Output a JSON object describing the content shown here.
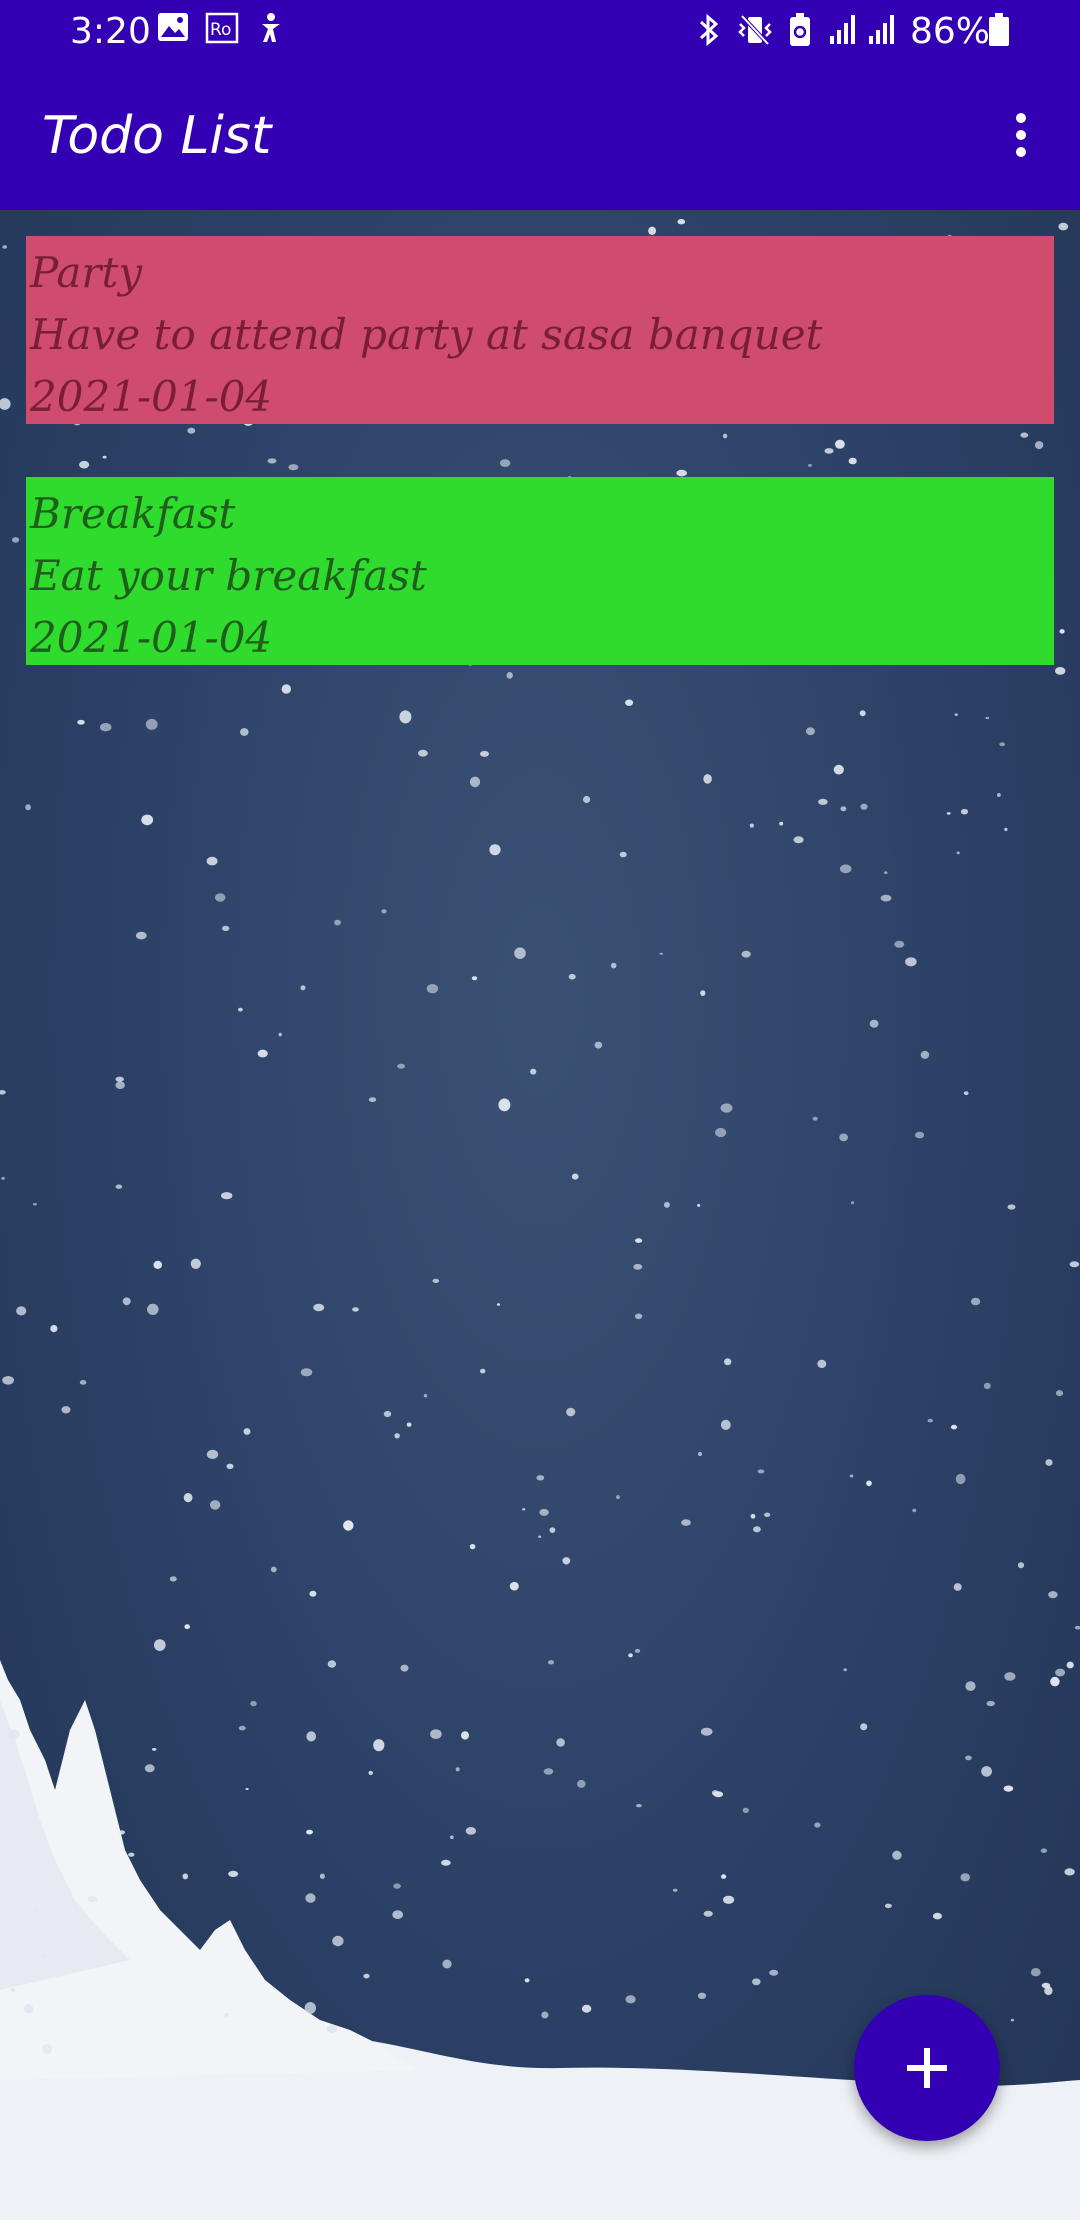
{
  "status_bar": {
    "time": "3:20",
    "battery_percent": "86%",
    "icons": [
      "gallery-icon",
      "ro-badge-icon",
      "accessibility-icon",
      "bluetooth-icon",
      "vibrate-icon",
      "battery-saver-icon",
      "signal-icon",
      "signal-icon",
      "battery-icon"
    ]
  },
  "app_bar": {
    "title": "Todo List",
    "menu_icon": "more-vert-icon"
  },
  "todos": [
    {
      "title": "Party",
      "description": "Have to attend party at sasa banquet",
      "date": "2021-01-04",
      "background_color": "#cf4c6f",
      "text_color": "#7a1f33"
    },
    {
      "title": "Breakfast",
      "description": "Eat your breakfast",
      "date": "2021-01-04",
      "background_color": "#2fdb2c",
      "text_color": "#1f5e1c"
    }
  ],
  "fab": {
    "icon": "plus-icon",
    "color": "#3300b3"
  },
  "colors": {
    "primary": "#3300b3",
    "wallpaper": "#2c4166"
  }
}
